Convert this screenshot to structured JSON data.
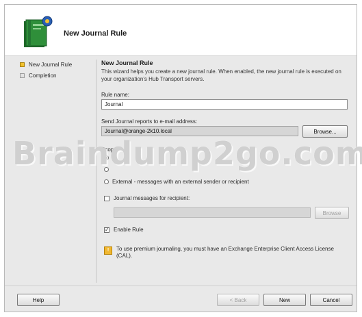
{
  "banner": {
    "title": "New Journal Rule"
  },
  "nav": {
    "items": [
      {
        "label": "New Journal Rule",
        "active": true
      },
      {
        "label": "Completion",
        "active": false
      }
    ]
  },
  "content": {
    "section_title": "New Journal Rule",
    "description": "This wizard helps you create a new journal rule. When enabled, the new journal rule is executed on your organization's Hub Transport servers.",
    "rule_name_label": "Rule name:",
    "rule_name_value": "Journal",
    "send_to_label": "Send Journal reports to e-mail address:",
    "send_to_value": "Journal@orange-2k10.local",
    "browse_label": "Browse...",
    "scope_label": "Scope:",
    "scope_options": [
      {
        "label": "",
        "selected": true
      },
      {
        "label": "",
        "selected": false
      },
      {
        "label": "External - messages with an external sender or recipient",
        "selected": false
      }
    ],
    "journal_recipient_label": "Journal messages for recipient:",
    "journal_recipient_value": "",
    "browse2_label": "Browse",
    "enable_rule_label": "Enable Rule",
    "enable_rule_checked": true,
    "info_text": "To use premium journaling, you must have an Exchange Enterprise Client Access License (CAL)."
  },
  "footer": {
    "help": "Help",
    "back": "< Back",
    "next": "New",
    "cancel": "Cancel"
  },
  "watermark": "Braindump2go.com"
}
